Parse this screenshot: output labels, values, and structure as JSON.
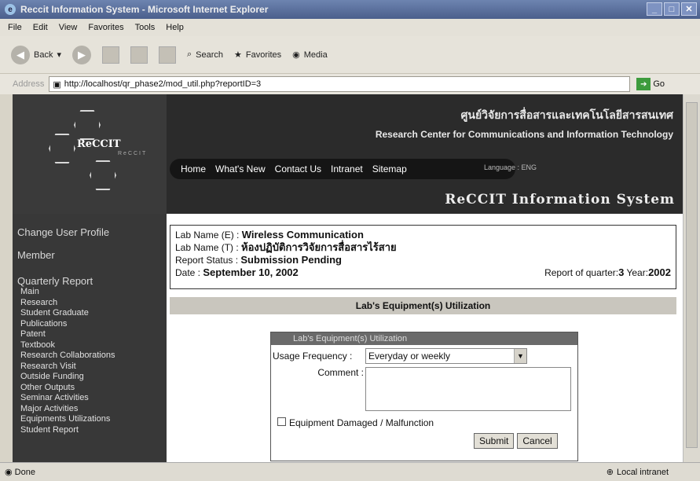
{
  "window": {
    "title": "Reccit Information System - Microsoft Internet Explorer"
  },
  "menu": [
    "File",
    "Edit",
    "View",
    "Favorites",
    "Tools",
    "Help"
  ],
  "toolbar": {
    "back": "Back",
    "search": "Search",
    "favorites": "Favorites",
    "media": "Media"
  },
  "address": {
    "label": "Address",
    "url": "http://localhost/qr_phase2/mod_util.php?reportID=3",
    "go": "Go"
  },
  "header": {
    "logo": "ReCCIT",
    "logo_sub": "ReCCIT",
    "thai_title": "ศูนย์วิจัยการสื่อสารและเทคโนโลยีสารสนเทศ",
    "eng_title": "Research Center for Communications and Information Technology",
    "nav": [
      "Home",
      "What's New",
      "Contact Us",
      "Intranet",
      "Sitemap"
    ],
    "language": "Language : ENG",
    "system_title": "ReCCIT Information System"
  },
  "sidebar": {
    "change_profile": "Change User Profile",
    "member": "Member",
    "quarterly": "Quarterly Report",
    "items": [
      "Main",
      "Research",
      "Student Graduate",
      "Publications",
      "Patent",
      "Textbook",
      "Research Collaborations",
      "Research Visit",
      "Outside Funding",
      "Other Outputs",
      "Seminar Activities",
      "Major Activities",
      "Equipments Utilizations",
      "Student Report"
    ]
  },
  "info": {
    "lab_e_label": "Lab Name (E) :",
    "lab_e": "Wireless Communication",
    "lab_t_label": "Lab Name (T) :",
    "lab_t": "ห้องปฏิบัติการวิจัยการสื่อสารไร้สาย",
    "status_label": "Report Status :",
    "status": "Submission Pending",
    "date_label": "Date :",
    "date": "September 10, 2002",
    "quarter_label": "Report of quarter:",
    "quarter": "3",
    "year_label": "Year:",
    "year": "2002"
  },
  "section_title": "Lab's Equipment(s) Utilization",
  "form": {
    "header": "Lab's Equipment(s) Utilization",
    "usage_label": "Usage Frequency :",
    "usage_value": "Everyday or weekly",
    "comment_label": "Comment :",
    "damaged_label": "Equipment Damaged / Malfunction",
    "submit": "Submit",
    "cancel": "Cancel"
  },
  "status": {
    "left": "Done",
    "zone": "Local intranet"
  }
}
